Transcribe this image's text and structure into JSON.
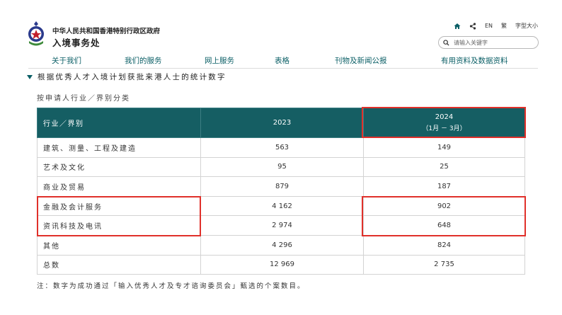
{
  "header": {
    "gov_name": "中华人民共和国香港特别行政区政府",
    "dept_name": "入境事务处",
    "utilities": {
      "home_icon": "home-icon",
      "share_icon": "share-icon",
      "lang_label": "EN",
      "traditional_label": "繁",
      "font_size_label": "字型大小"
    },
    "search": {
      "placeholder": "请输入关键字"
    }
  },
  "nav": {
    "items": [
      "关于我们",
      "我们的服务",
      "网上服务",
      "表格",
      "刊物及新闻公报",
      "有用资料及数据资料"
    ]
  },
  "section": {
    "title": "根据优秀人才入境计划获批来港人士的统计数字",
    "subtitle": "按申请人行业／界别分类"
  },
  "table": {
    "headers": {
      "category": "行业／界别",
      "year1": "2023",
      "year2": "2024",
      "year2_period": "（1月 － 3月）"
    },
    "rows": [
      {
        "category": "建筑、测量、工程及建造",
        "y2023": "563",
        "y2024": "149"
      },
      {
        "category": "艺术及文化",
        "y2023": "95",
        "y2024": "25"
      },
      {
        "category": "商业及贸易",
        "y2023": "879",
        "y2024": "187"
      },
      {
        "category": "金融及会计服务",
        "y2023": "4 162",
        "y2024": "902"
      },
      {
        "category": "资讯科技及电讯",
        "y2023": "2 974",
        "y2024": "648"
      },
      {
        "category": "其他",
        "y2023": "4 296",
        "y2024": "824"
      },
      {
        "category": "总数",
        "y2023": "12 969",
        "y2024": "2 735"
      }
    ]
  },
  "note": "注：数字为成功通过「输入优秀人才及专才谘询委员会」甄选的个案数目。",
  "colors": {
    "header_bg": "#155e63",
    "nav_text": "#0b5f66",
    "highlight": "#e0302a"
  }
}
